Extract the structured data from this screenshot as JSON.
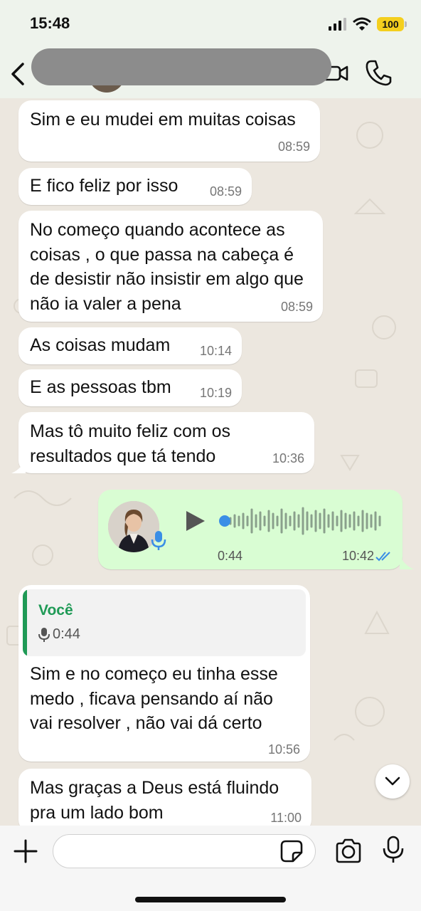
{
  "status_bar": {
    "time": "15:48",
    "battery": "100"
  },
  "header": {
    "contact_name": ""
  },
  "messages": [
    {
      "text": "Sim e eu mudei em muitas coisas",
      "time": "08:59"
    },
    {
      "text": "E fico feliz por isso",
      "time": "08:59"
    },
    {
      "text": "No começo quando acontece as coisas , o que passa na cabeça é de desistir não insistir em algo que não ia valer a pena",
      "time": "08:59"
    },
    {
      "text": "As coisas mudam",
      "time": "10:14"
    },
    {
      "text": "E as pessoas tbm",
      "time": "10:19"
    },
    {
      "text": "Mas tô muito feliz com os resultados que tá tendo",
      "time": "10:36"
    }
  ],
  "voice_message": {
    "duration": "0:44",
    "time": "10:42",
    "progress": 0,
    "status": "read"
  },
  "reply_message": {
    "quote_author": "Você",
    "quote_text": "0:44",
    "text": "Sim e no começo eu tinha esse medo , ficava pensando aí não vai resolver , não vai dá certo",
    "time": "10:56"
  },
  "last_message": {
    "text": "Mas graças a Deus está fluindo pra um lado bom",
    "time": "11:00"
  },
  "input": {
    "placeholder": ""
  },
  "colors": {
    "outgoing_bubble": "#d9fdd3",
    "accent": "#1f9a56",
    "read_ticks": "#3a8ee6"
  },
  "icons": [
    "back-icon",
    "video-call-icon",
    "phone-icon",
    "play-icon",
    "mic-icon",
    "double-check-icon",
    "chevron-down-icon",
    "plus-icon",
    "sticker-icon",
    "camera-icon"
  ]
}
